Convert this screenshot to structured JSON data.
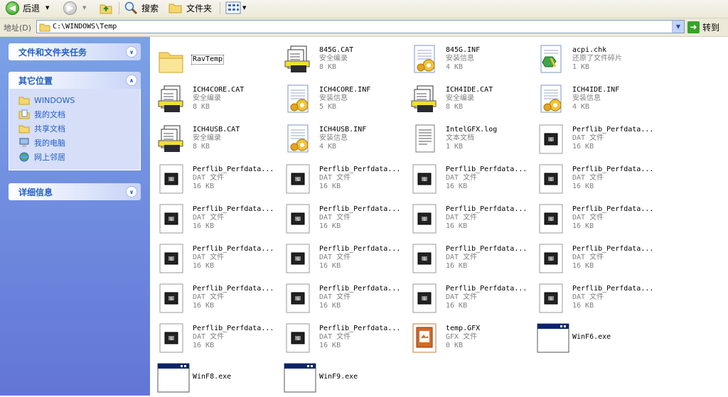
{
  "toolbar": {
    "back_label": "后退",
    "search_label": "搜索",
    "folders_label": "文件夹"
  },
  "address": {
    "label": "地址(D)",
    "path": "C:\\WINDOWS\\Temp",
    "go_label": "转到"
  },
  "sidebar": {
    "tasks_title": "文件和文件夹任务",
    "other_title": "其它位置",
    "details_title": "详细信息",
    "places": [
      {
        "label": "WINDOWS",
        "icon": "folder-icon"
      },
      {
        "label": "我的文档",
        "icon": "documents-icon"
      },
      {
        "label": "共享文档",
        "icon": "folder-icon"
      },
      {
        "label": "我的电脑",
        "icon": "computer-icon"
      },
      {
        "label": "网上邻居",
        "icon": "network-icon"
      }
    ]
  },
  "files": [
    {
      "name": "RavTemp",
      "type": "",
      "size": "",
      "icon": "folder"
    },
    {
      "name": "845G.CAT",
      "type": "安全编录",
      "size": "8 KB",
      "icon": "cat"
    },
    {
      "name": "845G.INF",
      "type": "安装信息",
      "size": "4 KB",
      "icon": "inf"
    },
    {
      "name": "acpi.chk",
      "type": "还原了文件碎片",
      "size": "1 KB",
      "icon": "chk"
    },
    {
      "name": "ICH4CORE.CAT",
      "type": "安全编录",
      "size": "8 KB",
      "icon": "cat"
    },
    {
      "name": "ICH4CORE.INF",
      "type": "安装信息",
      "size": "5 KB",
      "icon": "inf"
    },
    {
      "name": "ICH4IDE.CAT",
      "type": "安全编录",
      "size": "8 KB",
      "icon": "cat"
    },
    {
      "name": "ICH4IDE.INF",
      "type": "安装信息",
      "size": "4 KB",
      "icon": "inf"
    },
    {
      "name": "ICH4USB.CAT",
      "type": "安全编录",
      "size": "8 KB",
      "icon": "cat"
    },
    {
      "name": "ICH4USB.INF",
      "type": "安装信息",
      "size": "4 KB",
      "icon": "inf"
    },
    {
      "name": "IntelGFX.log",
      "type": "文本文档",
      "size": "1 KB",
      "icon": "log"
    },
    {
      "name": "Perflib_Perfdata...",
      "type": "DAT 文件",
      "size": "16 KB",
      "icon": "dat"
    },
    {
      "name": "Perflib_Perfdata...",
      "type": "DAT 文件",
      "size": "16 KB",
      "icon": "dat"
    },
    {
      "name": "Perflib_Perfdata...",
      "type": "DAT 文件",
      "size": "16 KB",
      "icon": "dat"
    },
    {
      "name": "Perflib_Perfdata...",
      "type": "DAT 文件",
      "size": "16 KB",
      "icon": "dat"
    },
    {
      "name": "Perflib_Perfdata...",
      "type": "DAT 文件",
      "size": "16 KB",
      "icon": "dat"
    },
    {
      "name": "Perflib_Perfdata...",
      "type": "DAT 文件",
      "size": "16 KB",
      "icon": "dat"
    },
    {
      "name": "Perflib_Perfdata...",
      "type": "DAT 文件",
      "size": "16 KB",
      "icon": "dat"
    },
    {
      "name": "Perflib_Perfdata...",
      "type": "DAT 文件",
      "size": "16 KB",
      "icon": "dat"
    },
    {
      "name": "Perflib_Perfdata...",
      "type": "DAT 文件",
      "size": "16 KB",
      "icon": "dat"
    },
    {
      "name": "Perflib_Perfdata...",
      "type": "DAT 文件",
      "size": "16 KB",
      "icon": "dat"
    },
    {
      "name": "Perflib_Perfdata...",
      "type": "DAT 文件",
      "size": "16 KB",
      "icon": "dat"
    },
    {
      "name": "Perflib_Perfdata...",
      "type": "DAT 文件",
      "size": "16 KB",
      "icon": "dat"
    },
    {
      "name": "Perflib_Perfdata...",
      "type": "DAT 文件",
      "size": "16 KB",
      "icon": "dat"
    },
    {
      "name": "Perflib_Perfdata...",
      "type": "DAT 文件",
      "size": "16 KB",
      "icon": "dat"
    },
    {
      "name": "Perflib_Perfdata...",
      "type": "DAT 文件",
      "size": "16 KB",
      "icon": "dat"
    },
    {
      "name": "Perflib_Perfdata...",
      "type": "DAT 文件",
      "size": "16 KB",
      "icon": "dat"
    },
    {
      "name": "Perflib_Perfdata...",
      "type": "DAT 文件",
      "size": "16 KB",
      "icon": "dat"
    },
    {
      "name": "Perflib_Perfdata...",
      "type": "DAT 文件",
      "size": "16 KB",
      "icon": "dat"
    },
    {
      "name": "Perflib_Perfdata...",
      "type": "DAT 文件",
      "size": "16 KB",
      "icon": "dat"
    },
    {
      "name": "temp.GFX",
      "type": "GFX 文件",
      "size": "0 KB",
      "icon": "gfx"
    },
    {
      "name": "WinF6.exe",
      "type": "",
      "size": "",
      "icon": "exe"
    },
    {
      "name": "WinF8.exe",
      "type": "",
      "size": "",
      "icon": "exe"
    },
    {
      "name": "WinF9.exe",
      "type": "",
      "size": "",
      "icon": "exe"
    }
  ]
}
